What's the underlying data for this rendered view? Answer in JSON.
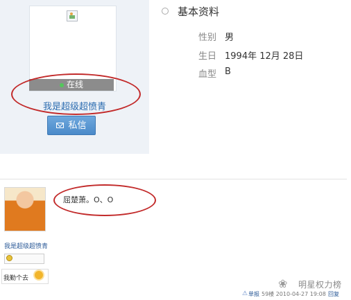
{
  "profile": {
    "online_label": "在线",
    "username": "我是超级超愤青",
    "pm_button_label": "私信"
  },
  "basic_info": {
    "title": "基本资料",
    "fields": [
      {
        "label": "性别",
        "value": "男"
      },
      {
        "label": "生日",
        "value": "1994年 12月 28日"
      },
      {
        "label": "血型",
        "value": "B"
      }
    ]
  },
  "post": {
    "author": "我是超级超愤青",
    "badge_text": "我勤个去",
    "content": "屈楚萧。O、O",
    "report_label": "单报",
    "floor_and_time": "59楼  2010-04-27 19:08",
    "reply_label": "回复"
  },
  "watermark": {
    "text": "明星权力榜"
  },
  "colors": {
    "annotation": "#c22a2a",
    "link": "#2b5a97",
    "button": "#4a8ac9"
  }
}
